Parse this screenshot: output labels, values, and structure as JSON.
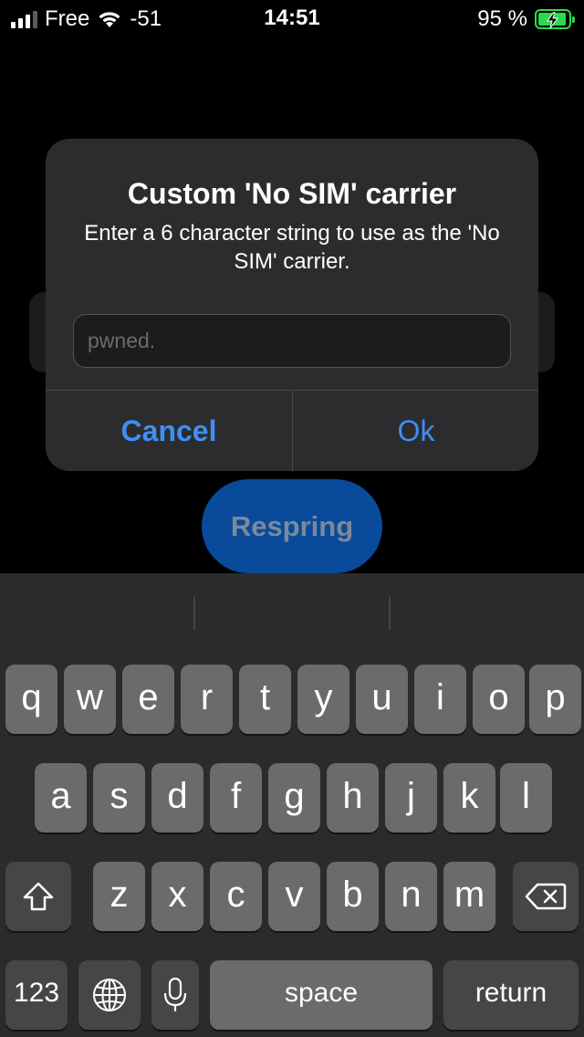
{
  "status_bar": {
    "carrier": "Free",
    "wifi_signal": "-51",
    "time": "14:51",
    "battery_text": "95 %",
    "battery_level": 0.95,
    "battery_color": "#2dd94f"
  },
  "background": {
    "respring_label": "Respring"
  },
  "alert": {
    "title": "Custom 'No SIM' carrier",
    "message": "Enter a 6 character string to use as the 'No SIM' carrier.",
    "input_value": "",
    "input_placeholder": "pwned.",
    "cancel_label": "Cancel",
    "ok_label": "Ok",
    "accent_color": "#3d8ff5"
  },
  "keyboard": {
    "row1": [
      "q",
      "w",
      "e",
      "r",
      "t",
      "y",
      "u",
      "i",
      "o",
      "p"
    ],
    "row2": [
      "a",
      "s",
      "d",
      "f",
      "g",
      "h",
      "j",
      "k",
      "l"
    ],
    "row3": [
      "z",
      "x",
      "c",
      "v",
      "b",
      "n",
      "m"
    ],
    "numbers_label": "123",
    "space_label": "space",
    "return_label": "return",
    "icons": [
      "shift-icon",
      "backspace-icon",
      "globe-icon",
      "microphone-icon"
    ]
  }
}
